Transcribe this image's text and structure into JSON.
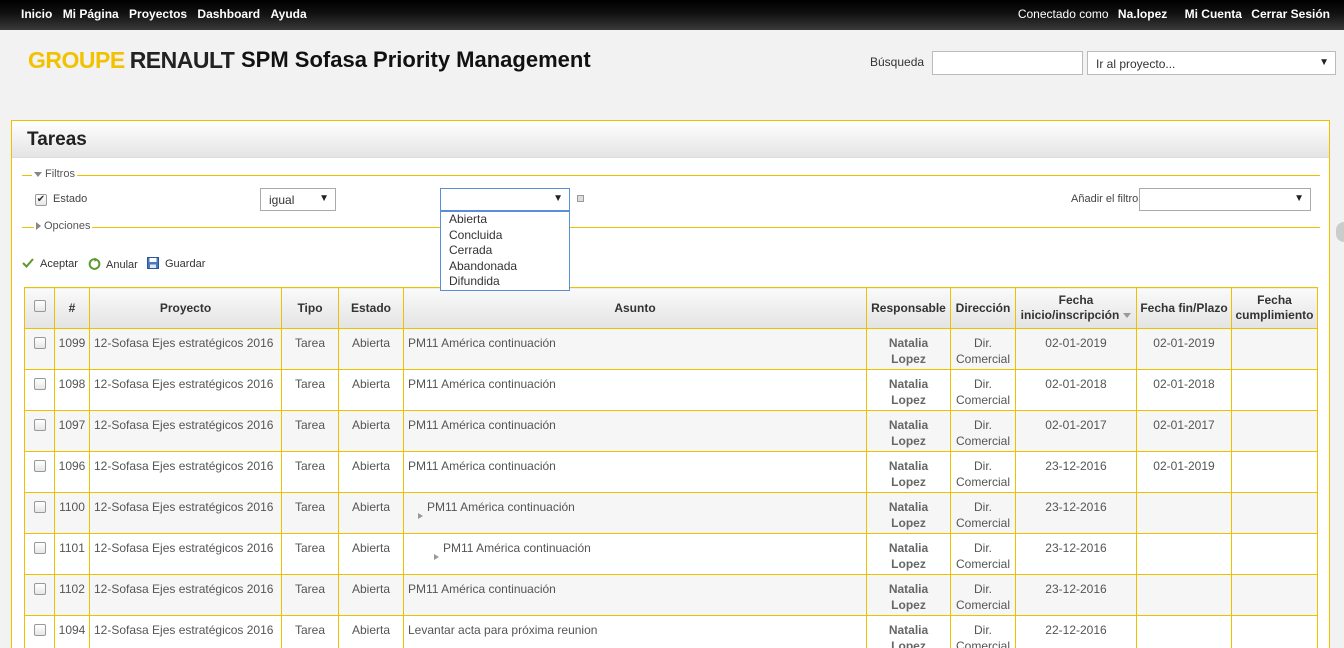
{
  "topbar": {
    "menu": [
      "Inicio",
      "Mi Página",
      "Proyectos",
      "Dashboard",
      "Ayuda"
    ],
    "connected_label": "Conectado como",
    "user": "Na.lopez",
    "my_account": "Mi Cuenta",
    "logout": "Cerrar Sesión"
  },
  "header": {
    "logo_groupe": "GROUPE",
    "logo_renault": "RENAULT",
    "app_title": "SPM Sofasa Priority Management",
    "search_label": "Búsqueda",
    "search_value": "",
    "project_select": "Ir al proyecto..."
  },
  "panel": {
    "title": "Tareas",
    "filters_legend": "Filtros",
    "options_legend": "Opciones",
    "filter": {
      "field_label": "Estado",
      "operator": "igual",
      "value": "",
      "options": [
        "Abierta",
        "Concluida",
        "Cerrada",
        "Abandonada",
        "Difundida"
      ]
    },
    "add_filter_label": "Añadir el filtro",
    "add_filter_value": "",
    "actions": {
      "apply": "Aceptar",
      "clear": "Anular",
      "save": "Guardar"
    }
  },
  "colors": {
    "accent": "#f0c000",
    "topbar": "#000000"
  },
  "table": {
    "columns": [
      "#",
      "Proyecto",
      "Tipo",
      "Estado",
      "Asunto",
      "Responsable",
      "Dirección",
      "Fecha inicio/inscripción",
      "Fecha fin/Plazo",
      "Fecha cumplimiento"
    ],
    "rows": [
      {
        "id": "1099",
        "project": "12-Sofasa Ejes estratégicos 2016",
        "type": "Tarea",
        "status": "Abierta",
        "subject": "PM11 América continuación",
        "indent": 0,
        "resp1": "Natalia",
        "resp2": "Lopez",
        "dir1": "Dir.",
        "dir2": "Comercial",
        "start": "02-01-2019",
        "due": "02-01-2019",
        "done": ""
      },
      {
        "id": "1098",
        "project": "12-Sofasa Ejes estratégicos 2016",
        "type": "Tarea",
        "status": "Abierta",
        "subject": "PM11 América continuación",
        "indent": 0,
        "resp1": "Natalia",
        "resp2": "Lopez",
        "dir1": "Dir.",
        "dir2": "Comercial",
        "start": "02-01-2018",
        "due": "02-01-2018",
        "done": ""
      },
      {
        "id": "1097",
        "project": "12-Sofasa Ejes estratégicos 2016",
        "type": "Tarea",
        "status": "Abierta",
        "subject": "PM11 América continuación",
        "indent": 0,
        "resp1": "Natalia",
        "resp2": "Lopez",
        "dir1": "Dir.",
        "dir2": "Comercial",
        "start": "02-01-2017",
        "due": "02-01-2017",
        "done": ""
      },
      {
        "id": "1096",
        "project": "12-Sofasa Ejes estratégicos 2016",
        "type": "Tarea",
        "status": "Abierta",
        "subject": "PM11 América continuación",
        "indent": 0,
        "resp1": "Natalia",
        "resp2": "Lopez",
        "dir1": "Dir.",
        "dir2": "Comercial",
        "start": "23-12-2016",
        "due": "02-01-2019",
        "done": ""
      },
      {
        "id": "1100",
        "project": "12-Sofasa Ejes estratégicos 2016",
        "type": "Tarea",
        "status": "Abierta",
        "subject": "PM11 América continuación",
        "indent": 1,
        "resp1": "Natalia",
        "resp2": "Lopez",
        "dir1": "Dir.",
        "dir2": "Comercial",
        "start": "23-12-2016",
        "due": "",
        "done": ""
      },
      {
        "id": "1101",
        "project": "12-Sofasa Ejes estratégicos 2016",
        "type": "Tarea",
        "status": "Abierta",
        "subject": "PM11 América continuación",
        "indent": 2,
        "resp1": "Natalia",
        "resp2": "Lopez",
        "dir1": "Dir.",
        "dir2": "Comercial",
        "start": "23-12-2016",
        "due": "",
        "done": ""
      },
      {
        "id": "1102",
        "project": "12-Sofasa Ejes estratégicos 2016",
        "type": "Tarea",
        "status": "Abierta",
        "subject": "PM11 América continuación",
        "indent": 0,
        "resp1": "Natalia",
        "resp2": "Lopez",
        "dir1": "Dir.",
        "dir2": "Comercial",
        "start": "23-12-2016",
        "due": "",
        "done": ""
      },
      {
        "id": "1094",
        "project": "12-Sofasa Ejes estratégicos 2016",
        "type": "Tarea",
        "status": "Abierta",
        "subject": "Levantar acta para próxima reunion",
        "indent": 0,
        "resp1": "Natalia",
        "resp2": "Lopez",
        "dir1": "Dir.",
        "dir2": "Comercial",
        "start": "22-12-2016",
        "due": "",
        "done": ""
      }
    ]
  }
}
